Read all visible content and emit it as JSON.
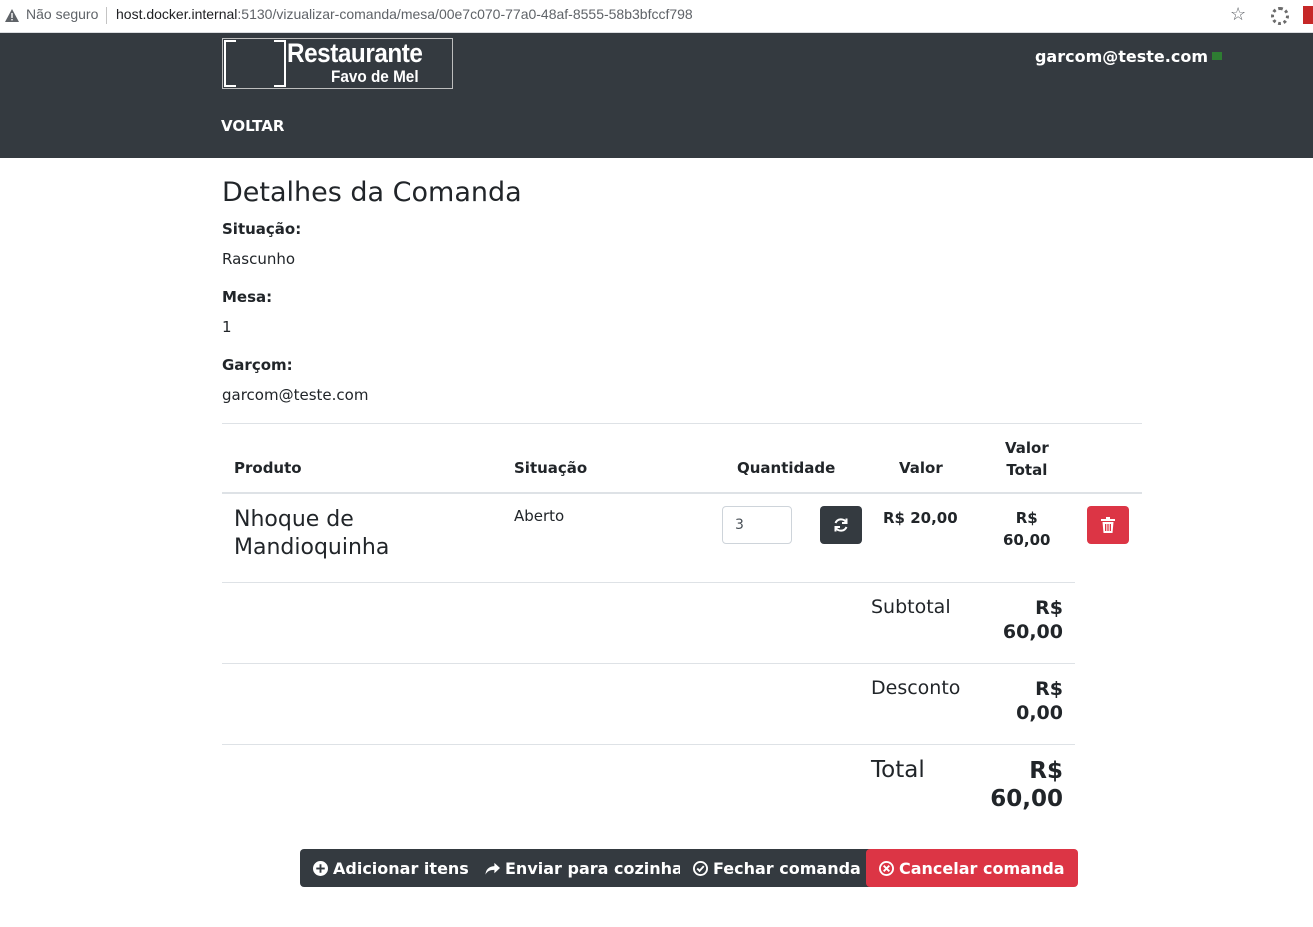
{
  "browser": {
    "security_label": "Não seguro",
    "url_host": "host.docker.internal",
    "url_path": ":5130/vizualizar-comanda/mesa/00e7c070-77a0-48af-8555-58b3bfccf798"
  },
  "navbar": {
    "logo_title": "Restaurante",
    "logo_subtitle": "Favo de Mel",
    "user_email": "garcom@teste.com",
    "back_label": "VOLTAR"
  },
  "page": {
    "title": "Detalhes da Comanda",
    "fields": {
      "status_label": "Situação:",
      "status_value": "Rascunho",
      "table_label": "Mesa:",
      "table_value": "1",
      "waiter_label": "Garçom:",
      "waiter_value": "garcom@teste.com"
    }
  },
  "table": {
    "headers": {
      "product": "Produto",
      "status": "Situação",
      "quantity": "Quantidade",
      "value": "Valor",
      "total_line1": "Valor",
      "total_line2": "Total"
    },
    "rows": [
      {
        "product": "Nhoque de Mandioquinha",
        "status": "Aberto",
        "quantity": "3",
        "value": "R$ 20,00",
        "total_line1": "R$",
        "total_line2": "60,00"
      }
    ]
  },
  "summary": {
    "subtotal_label": "Subtotal",
    "subtotal_currency": "R$",
    "subtotal_amount": "60,00",
    "discount_label": "Desconto",
    "discount_currency": "R$",
    "discount_amount": "0,00",
    "total_label": "Total",
    "total_currency": "R$",
    "total_amount": "60,00"
  },
  "actions": {
    "add_items": "Adicionar itens",
    "send_kitchen": "Enviar para cozinha",
    "close_order": "Fechar comanda",
    "cancel_order": "Cancelar comanda"
  },
  "colors": {
    "navbar": "#343a40",
    "danger": "#dc3545",
    "dark_button": "#343a40"
  }
}
